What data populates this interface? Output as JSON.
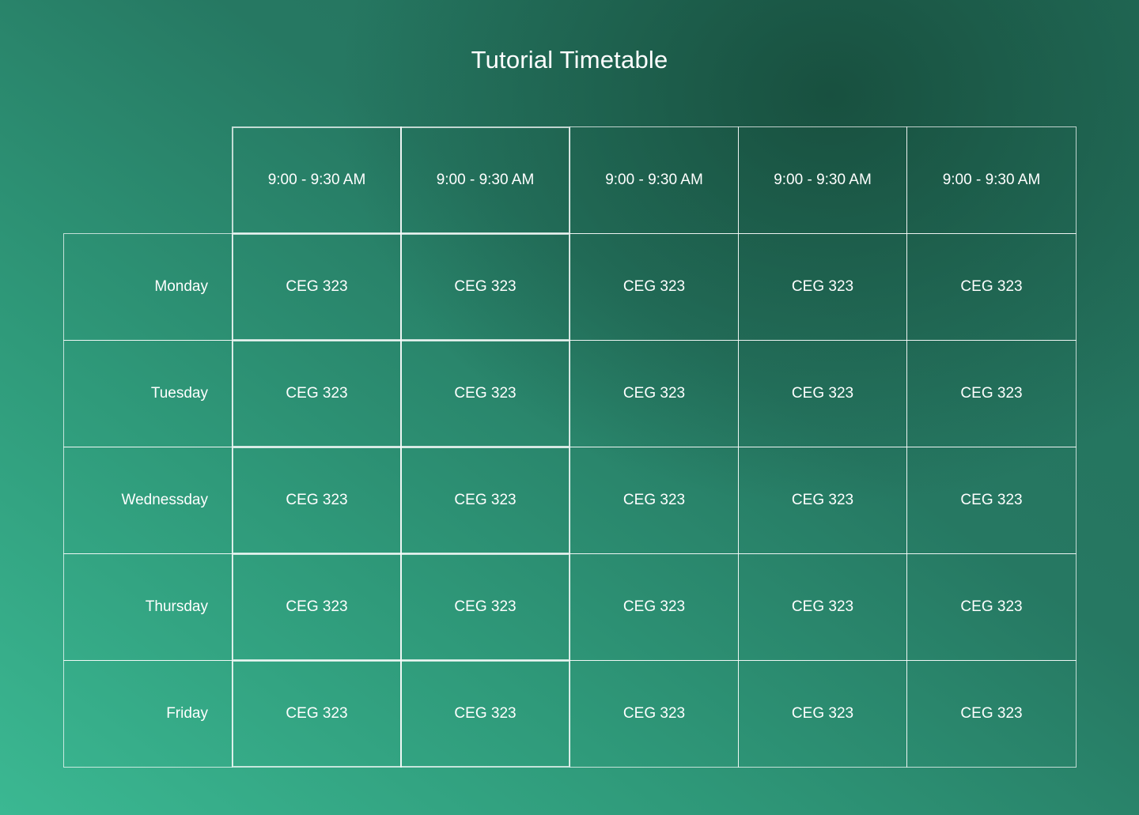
{
  "title": "Tutorial Timetable",
  "time_slots": [
    "9:00 - 9:30 AM",
    "9:00 - 9:30 AM",
    "9:00 - 9:30 AM",
    "9:00 - 9:30 AM",
    "9:00 - 9:30 AM"
  ],
  "days": [
    {
      "name": "Monday",
      "slots": [
        "CEG 323",
        "CEG 323",
        "CEG 323",
        "CEG 323",
        "CEG 323"
      ]
    },
    {
      "name": "Tuesday",
      "slots": [
        "CEG 323",
        "CEG 323",
        "CEG 323",
        "CEG 323",
        "CEG 323"
      ]
    },
    {
      "name": "Wednessday",
      "slots": [
        "CEG 323",
        "CEG 323",
        "CEG 323",
        "CEG 323",
        "CEG 323"
      ]
    },
    {
      "name": "Thursday",
      "slots": [
        "CEG 323",
        "CEG 323",
        "CEG 323",
        "CEG 323",
        "CEG 323"
      ]
    },
    {
      "name": "Friday",
      "slots": [
        "CEG 323",
        "CEG 323",
        "CEG 323",
        "CEG 323",
        "CEG 323"
      ]
    }
  ]
}
